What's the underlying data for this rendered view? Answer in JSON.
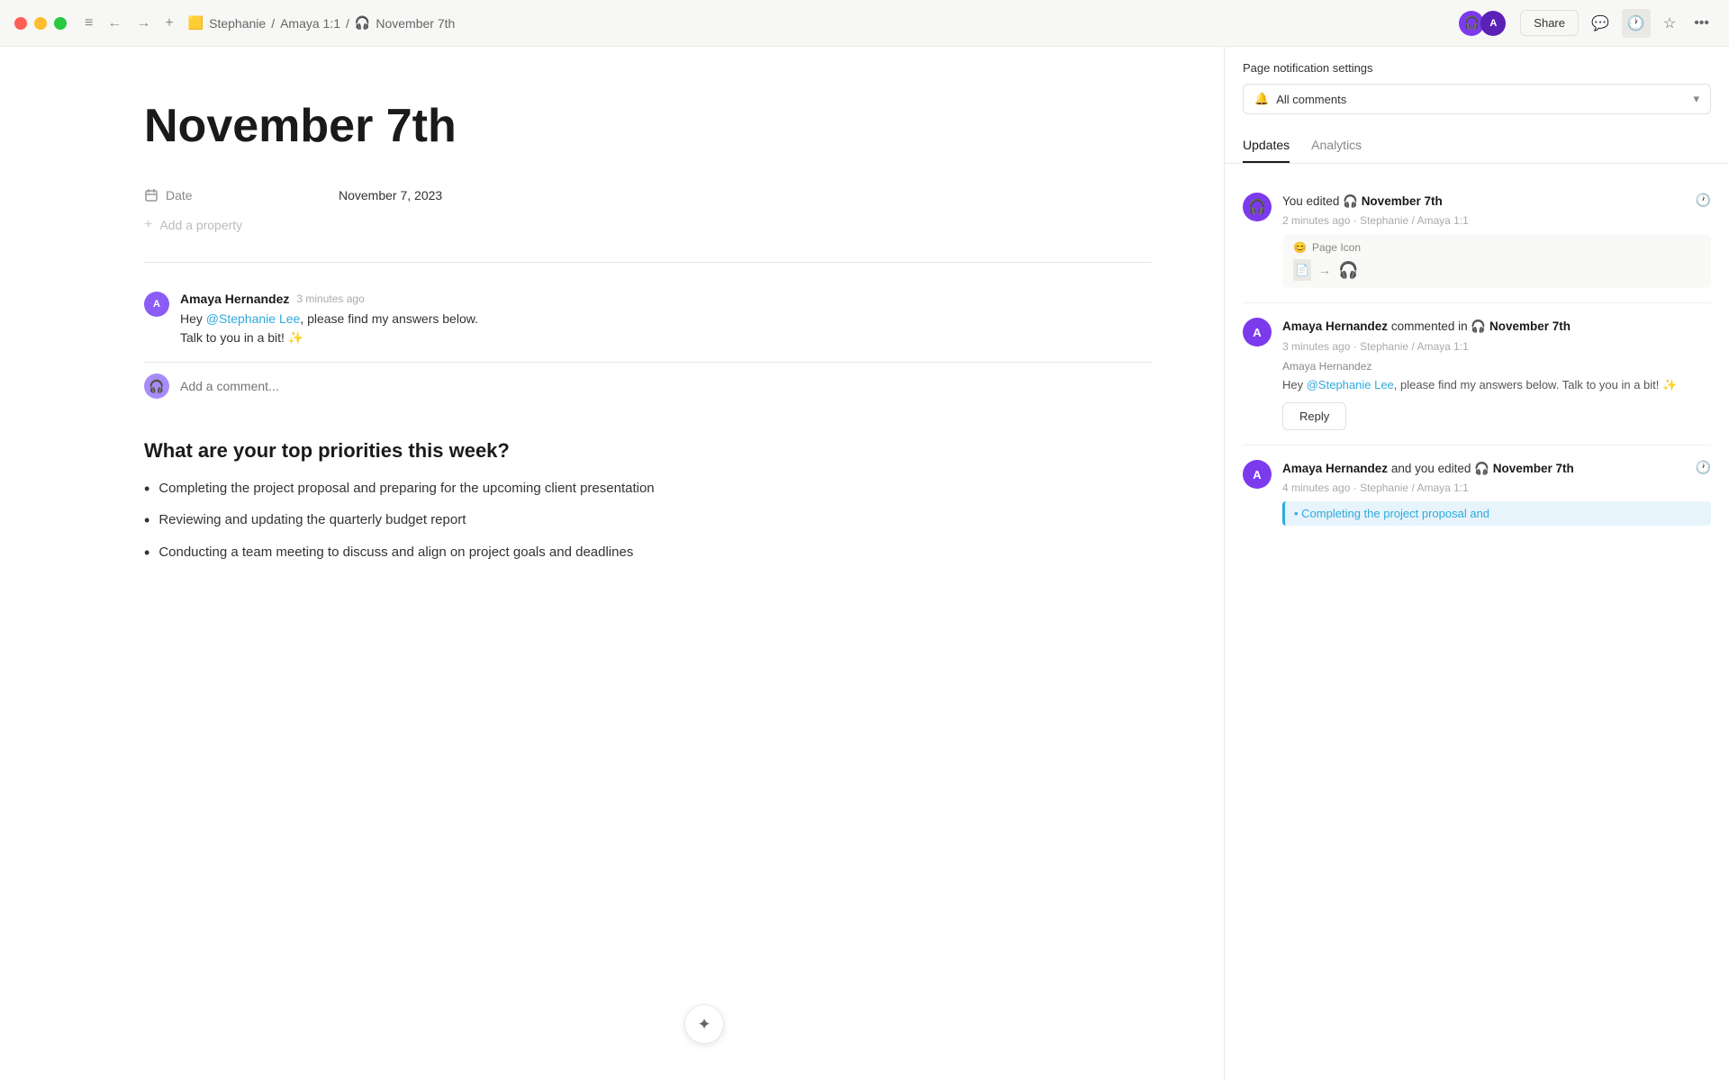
{
  "titlebar": {
    "expand_icon": "≡",
    "back_icon": "←",
    "forward_icon": "→",
    "add_icon": "+",
    "workspace_icon": "🟨",
    "breadcrumb_workspace": "Stephanie",
    "breadcrumb_separator1": "/",
    "breadcrumb_page": "Amaya 1:1",
    "breadcrumb_separator2": "/",
    "breadcrumb_page_icon": "🎧",
    "breadcrumb_current": "November 7th",
    "share_label": "Share",
    "comment_icon": "💬",
    "history_icon": "🕐",
    "star_icon": "☆",
    "more_icon": "•••"
  },
  "page": {
    "title": "November 7th",
    "property_label": "Date",
    "property_value": "November 7, 2023",
    "add_property_label": "Add a property"
  },
  "comments": {
    "author": "Amaya Hernandez",
    "time": "3 minutes ago",
    "text_part1": "Hey ",
    "mention": "@Stephanie Lee",
    "text_part2": ", please find my answers below.",
    "text_line2": "Talk to you in a bit! ✨",
    "add_comment_placeholder": "Add a comment..."
  },
  "content": {
    "heading": "What are your top priorities this week?",
    "bullets": [
      "Completing the project proposal and preparing for the upcoming client presentation",
      "Reviewing and updating the quarterly budget report",
      "Conducting a team meeting to discuss and align on project goals and deadlines"
    ]
  },
  "right_panel": {
    "notification_settings_title": "Page notification settings",
    "notification_option": "All comments",
    "tab_updates": "Updates",
    "tab_analytics": "Analytics",
    "updates": [
      {
        "id": "update1",
        "actor": "You",
        "action": "edited",
        "page_icon": "🎧",
        "page_name": "November 7th",
        "time": "2 minutes ago",
        "path": "Stephanie / Amaya 1:1",
        "detail_type": "page_icon_change",
        "detail_label": "Page Icon",
        "from_icon": "📄",
        "arrow": "→",
        "to_icon": "🎧"
      },
      {
        "id": "update2",
        "actor": "Amaya Hernandez",
        "action": "commented in",
        "page_icon": "🎧",
        "page_name": "November 7th",
        "time": "3 minutes ago",
        "path": "Stephanie / Amaya 1:1",
        "comment_author": "Amaya Hernandez",
        "comment_mention": "@Stephanie Lee",
        "comment_text1": "Hey ",
        "comment_text2": ", please find my answers below. Talk to you in a bit! ✨",
        "reply_label": "Reply"
      },
      {
        "id": "update3",
        "actor": "Amaya Hernandez",
        "action": "and you edited",
        "page_icon": "🎧",
        "page_name": "November 7th",
        "time": "4 minutes ago",
        "path": "Stephanie / Amaya 1:1",
        "highlight_text": "Completing the project proposal and"
      }
    ]
  }
}
